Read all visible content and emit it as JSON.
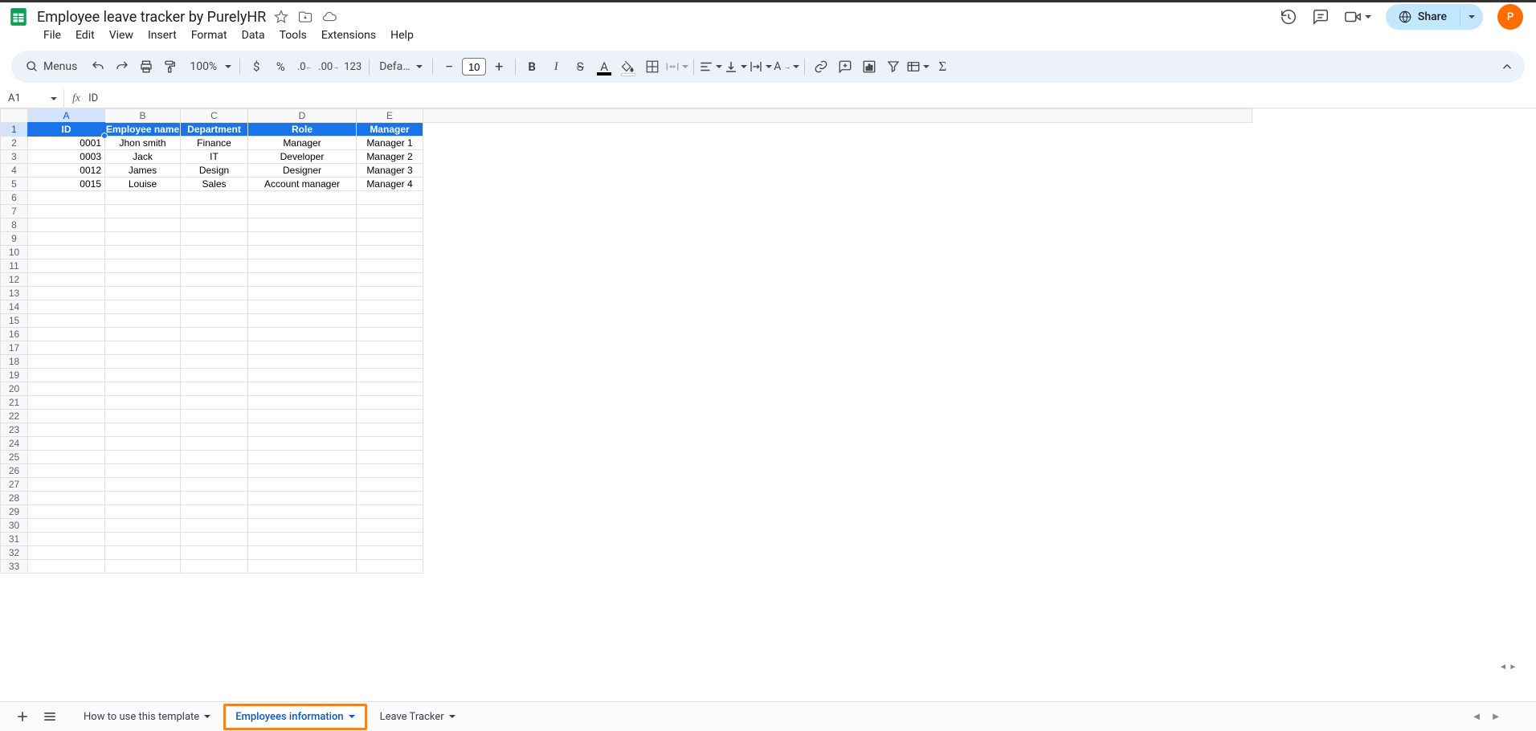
{
  "doc_title": "Employee leave tracker by PurelyHR",
  "menus": [
    "File",
    "Edit",
    "View",
    "Insert",
    "Format",
    "Data",
    "Tools",
    "Extensions",
    "Help"
  ],
  "toolbar": {
    "menus_label": "Menus",
    "zoom": "100%",
    "font": "Defaul...",
    "font_size": "10",
    "fmt_123": "123"
  },
  "name_box": "A1",
  "formula": "ID",
  "share_label": "Share",
  "avatar_initial": "P",
  "columns": [
    {
      "letter": "A",
      "cls": "col-A",
      "selected": true
    },
    {
      "letter": "B",
      "cls": "col-B"
    },
    {
      "letter": "C",
      "cls": "col-C"
    },
    {
      "letter": "D",
      "cls": "col-D"
    },
    {
      "letter": "E",
      "cls": "col-E"
    }
  ],
  "header_row": [
    "ID",
    "Employee name",
    "Department",
    "Role",
    "Manager"
  ],
  "data_rows": [
    [
      "0001",
      "Jhon smith",
      "Finance",
      "Manager",
      "Manager 1"
    ],
    [
      "0003",
      "Jack",
      "IT",
      "Developer",
      "Manager 2"
    ],
    [
      "0012",
      "James",
      "Design",
      "Designer",
      "Manager 3"
    ],
    [
      "0015",
      "Louise",
      "Sales",
      "Account manager",
      "Manager 4"
    ]
  ],
  "total_rows": 33,
  "sheet_tabs": [
    {
      "label": "How to use this template",
      "active": false
    },
    {
      "label": "Employees information",
      "active": true
    },
    {
      "label": "Leave Tracker",
      "active": false
    }
  ]
}
